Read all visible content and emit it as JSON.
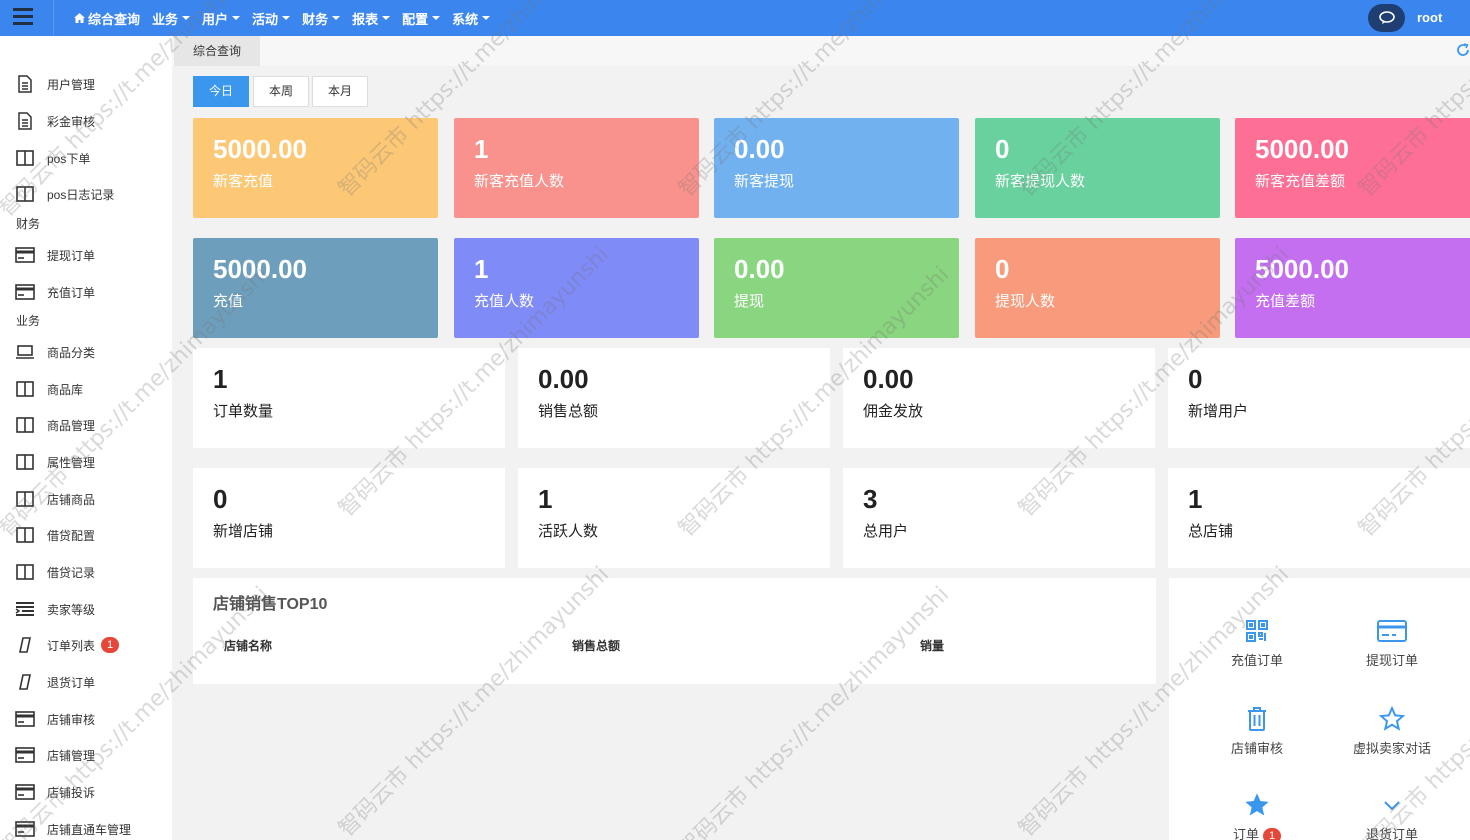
{
  "topbar": {
    "nav": [
      {
        "label": "综合查询",
        "icon": "home-icon",
        "caret": false
      },
      {
        "label": "业务",
        "caret": true
      },
      {
        "label": "用户",
        "caret": true
      },
      {
        "label": "活动",
        "caret": true
      },
      {
        "label": "财务",
        "caret": true
      },
      {
        "label": "报表",
        "caret": true
      },
      {
        "label": "配置",
        "caret": true
      },
      {
        "label": "系统",
        "caret": true
      }
    ],
    "user": "root"
  },
  "sidebar": {
    "items": [
      {
        "label": "用户管理",
        "icon": "document-icon"
      },
      {
        "label": "彩金审核",
        "icon": "document-icon"
      },
      {
        "label": "pos下单",
        "icon": "columns-icon"
      },
      {
        "label": "pos日志记录",
        "icon": "columns-icon"
      },
      {
        "label": "提现订单",
        "icon": "card-icon"
      },
      {
        "label": "充值订单",
        "icon": "card-icon"
      },
      {
        "label": "商品分类",
        "icon": "laptop-icon"
      },
      {
        "label": "商品库",
        "icon": "columns-icon"
      },
      {
        "label": "商品管理",
        "icon": "columns-icon"
      },
      {
        "label": "属性管理",
        "icon": "columns-icon"
      },
      {
        "label": "店铺商品",
        "icon": "columns-icon"
      },
      {
        "label": "借贷配置",
        "icon": "columns-icon"
      },
      {
        "label": "借贷记录",
        "icon": "columns-icon"
      },
      {
        "label": "卖家等级",
        "icon": "list-icon"
      },
      {
        "label": "订单列表",
        "icon": "slash-icon",
        "badge": "1"
      },
      {
        "label": "退货订单",
        "icon": "slash-icon"
      },
      {
        "label": "店铺审核",
        "icon": "card-icon"
      },
      {
        "label": "店铺管理",
        "icon": "card-icon"
      },
      {
        "label": "店铺投诉",
        "icon": "card-icon"
      },
      {
        "label": "店铺直通车管理",
        "icon": "card-icon"
      }
    ],
    "sections": [
      "财务",
      "业务"
    ]
  },
  "tabbar": {
    "active": "综合查询"
  },
  "period": {
    "today": "今日",
    "week": "本周",
    "month": "本月"
  },
  "colored_cards": [
    {
      "value": "5000.00",
      "label": "新客充值",
      "color": "#fcc876"
    },
    {
      "value": "1",
      "label": "新客充值人数",
      "color": "#f9928c"
    },
    {
      "value": "0.00",
      "label": "新客提现",
      "color": "#72b1f0"
    },
    {
      "value": "0",
      "label": "新客提现人数",
      "color": "#68d19e"
    },
    {
      "value": "5000.00",
      "label": "新客充值差额",
      "color": "#fd6f95"
    },
    {
      "value": "5000.00",
      "label": "充值",
      "color": "#6d9fbd"
    },
    {
      "value": "1",
      "label": "充值人数",
      "color": "#7f8bf7"
    },
    {
      "value": "0.00",
      "label": "提现",
      "color": "#8ad57f"
    },
    {
      "value": "0",
      "label": "提现人数",
      "color": "#f79b7c"
    },
    {
      "value": "5000.00",
      "label": "充值差额",
      "color": "#c36ff0"
    }
  ],
  "white_cards": [
    {
      "value": "1",
      "label": "订单数量"
    },
    {
      "value": "0.00",
      "label": "销售总额"
    },
    {
      "value": "0.00",
      "label": "佣金发放"
    },
    {
      "value": "0",
      "label": "新增用户"
    },
    {
      "value": "0",
      "label": "新增店铺"
    },
    {
      "value": "1",
      "label": "活跃人数"
    },
    {
      "value": "3",
      "label": "总用户"
    },
    {
      "value": "1",
      "label": "总店铺"
    }
  ],
  "top10": {
    "title": "店铺销售TOP10",
    "columns": [
      "店铺名称",
      "销售总额",
      "销量"
    ]
  },
  "shortcuts": [
    {
      "label": "充值订单",
      "icon": "qrcode-icon"
    },
    {
      "label": "提现订单",
      "icon": "credit-card-icon"
    },
    {
      "label": "店铺审核",
      "icon": "trash-icon"
    },
    {
      "label": "虚拟卖家对话",
      "icon": "star-outline-icon"
    },
    {
      "label": "订单",
      "icon": "star-filled-icon",
      "badge": "1"
    },
    {
      "label": "退货订单",
      "icon": "chevron-down-icon"
    }
  ],
  "watermark": {
    "text": "智码云市 https://t.me/zhimayunshi"
  },
  "colors": {
    "topbar": "#3b86ee",
    "accent": "#3b97ee",
    "badge": "#e6473b",
    "icon_blue": "#3b97ee"
  }
}
